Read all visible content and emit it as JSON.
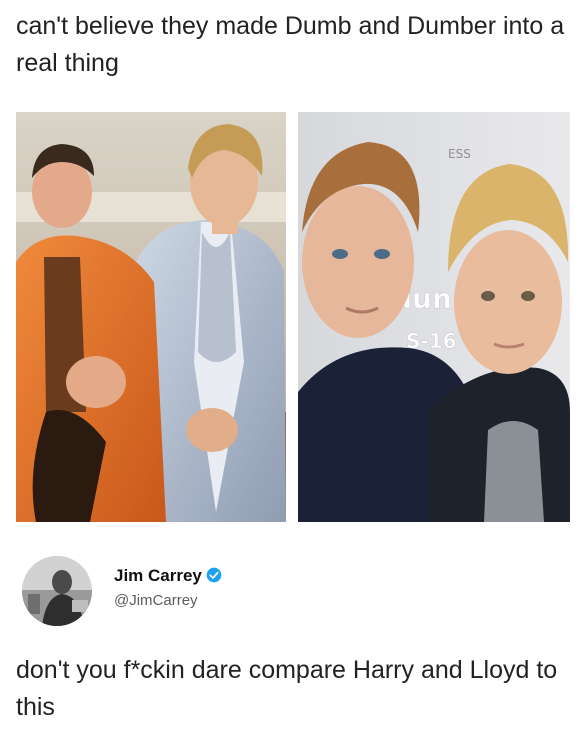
{
  "post": {
    "caption": "can't believe they made Dumb and Dumber into a real thing"
  },
  "images": {
    "left": {
      "subject": "dumb-and-dumber-movie-still"
    },
    "right": {
      "subject": "selfie-two-blond-young-men",
      "backdrop_text": "dun",
      "backdrop_text_2": "S-16",
      "backdrop_text_3": "ESS"
    }
  },
  "tweet": {
    "author_name": "Jim Carrey",
    "author_handle": "@JimCarrey",
    "text": "don't you f*ckin dare compare Harry and Lloyd to this",
    "verified_color": "#1da1f2"
  }
}
